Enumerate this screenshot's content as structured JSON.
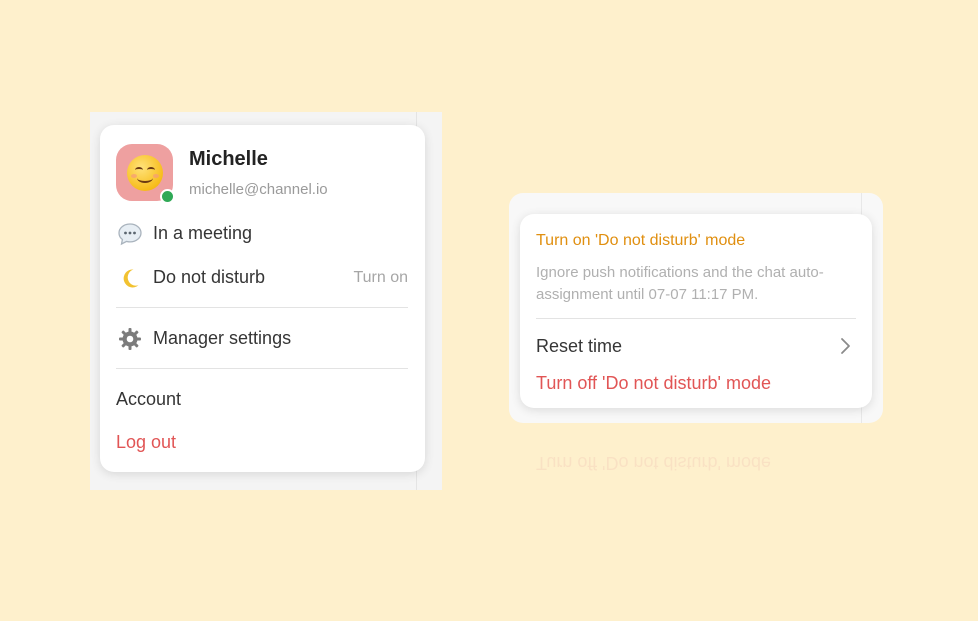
{
  "profile": {
    "name": "Michelle",
    "email": "michelle@channel.io"
  },
  "menu": {
    "meeting_label": "In a meeting",
    "dnd_label": "Do not disturb",
    "dnd_action": "Turn on",
    "settings_label": "Manager settings",
    "account_label": "Account",
    "logout_label": "Log out"
  },
  "dnd_popup": {
    "title": "Turn on 'Do not disturb' mode",
    "description": "Ignore push notifications and the chat auto-assignment until 07-07 11:17 PM.",
    "reset_label": "Reset time",
    "turn_off_label": "Turn off 'Do not disturb' mode",
    "reflection_text": "Turn off 'Do not disturb' mode"
  },
  "icons": {
    "avatar": "smiling-face-icon",
    "status": "online-status-icon",
    "meeting": "speech-bubble-icon",
    "dnd": "crescent-moon-icon",
    "settings": "gear-icon",
    "reset_chevron": "chevron-right-icon"
  },
  "colors": {
    "background": "#fef0cc",
    "accent_orange": "#e08f10",
    "danger_red": "#e15555",
    "online_green": "#2fa956",
    "avatar_bg": "#eea0a0"
  }
}
